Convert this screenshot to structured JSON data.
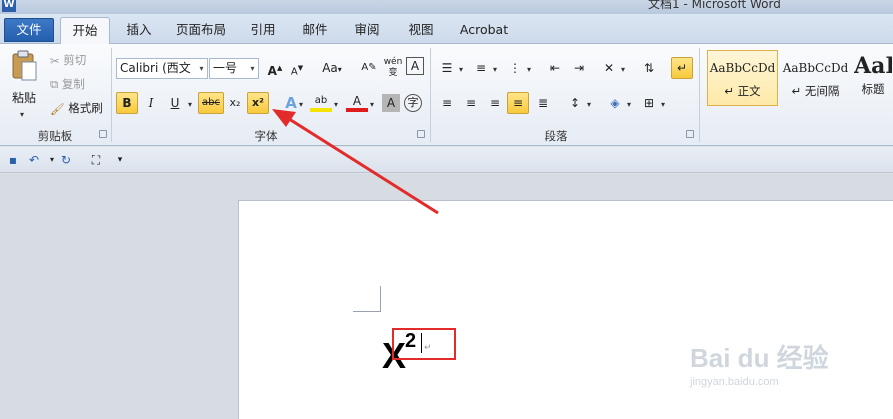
{
  "window": {
    "title": "文档1 - Microsoft Word",
    "app_icon": "W"
  },
  "tabs": [
    {
      "label": "文件"
    },
    {
      "label": "开始"
    },
    {
      "label": "插入"
    },
    {
      "label": "页面布局"
    },
    {
      "label": "引用"
    },
    {
      "label": "邮件"
    },
    {
      "label": "审阅"
    },
    {
      "label": "视图"
    },
    {
      "label": "Acrobat"
    }
  ],
  "clipboard": {
    "paste": "粘贴",
    "cut": "剪切",
    "copy": "复制",
    "format_painter": "格式刷",
    "group": "剪贴板"
  },
  "font": {
    "name": "Calibri (西文",
    "size": "一号",
    "grow": "A",
    "shrink": "A",
    "change_case": "Aa",
    "wen": "wén",
    "bold": "B",
    "italic": "I",
    "underline": "U",
    "strike": "abc",
    "subscript": "x₂",
    "superscript": "x²",
    "highlight": "ab",
    "font_color": "A",
    "char_shading": "A",
    "enclose": "字",
    "group": "字体"
  },
  "paragraph": {
    "group": "段落"
  },
  "styles": [
    {
      "sample": "AaBbCcDd",
      "name": "↵ 正文"
    },
    {
      "sample": "AaBbCcDd",
      "name": "↵ 无间隔"
    },
    {
      "sample": "AaI",
      "name": "标题"
    }
  ],
  "document": {
    "base": "X",
    "exponent": "2",
    "paragraph_mark": "↵"
  },
  "watermark": {
    "brand": "Bai du 经验",
    "url": "jingyan.baidu.com"
  },
  "colors": {
    "annotation": "#e32b2b",
    "highlight_active": "#f8c93b"
  }
}
